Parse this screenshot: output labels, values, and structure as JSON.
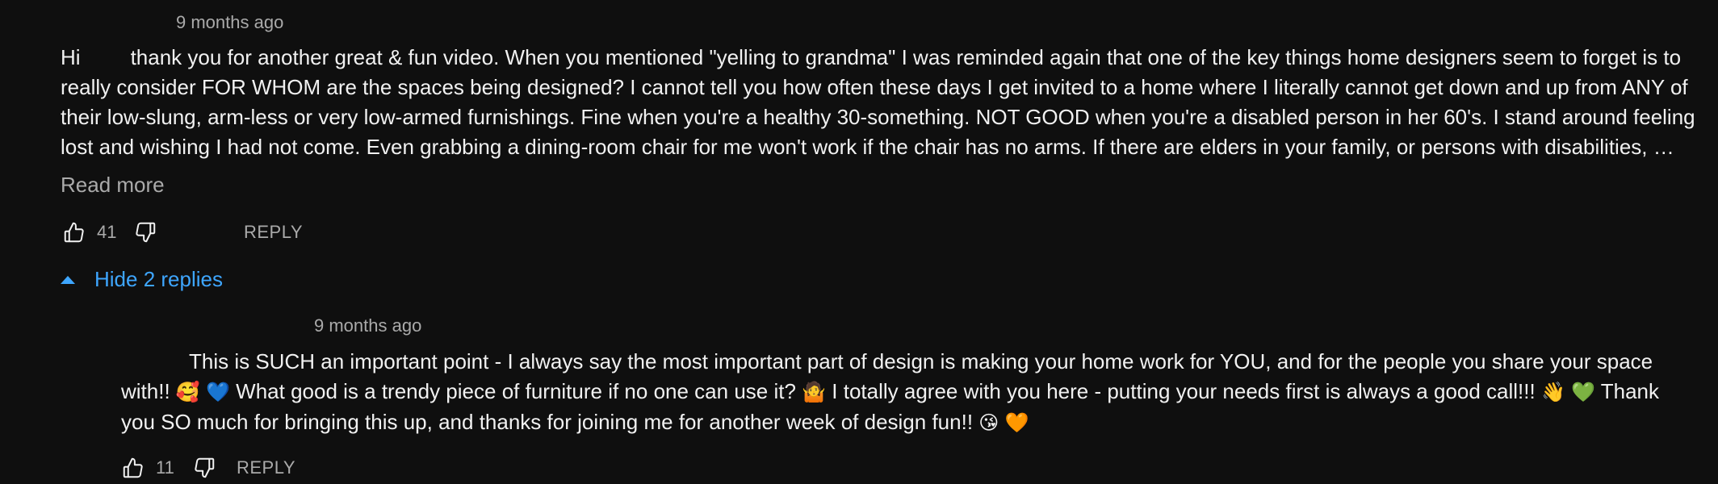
{
  "top_comment": {
    "timestamp": "9 months ago",
    "text_greeting": "Hi",
    "text_body": "thank you for another great & fun video. When you mentioned \"yelling to grandma\" I was reminded again that one of the key things home designers seem to forget is to really consider FOR WHOM are the spaces being designed? I cannot tell you how often these days I get invited to a home where I literally cannot get down and up from ANY of their low-slung, arm-less or very low-armed furnishings. Fine when you're a healthy 30-something. NOT GOOD when you're a disabled person in her 60's. I stand around feeling lost and wishing I had not come. Even grabbing a dining-room chair for me won't work if the chair has no arms. If there are elders in your family, or persons with disabilities, …",
    "read_more_label": "Read more",
    "like_count": "41",
    "reply_label": "REPLY"
  },
  "replies_toggle": {
    "label": "Hide 2 replies",
    "color": "#3ea6ff"
  },
  "reply_comment": {
    "timestamp": "9 months ago",
    "text_part1": "This is SUCH an important point - I always say the most important part of design is making your home work for YOU, and for the people you share your space with!!",
    "emoji_1": "🥰",
    "emoji_2": "💙",
    "text_part2": "What good is a trendy piece of furniture if no one can use it?",
    "emoji_3": "🤷",
    "text_part3": "I totally agree with you here - putting your needs first is always a good call!!!",
    "emoji_4": "👋",
    "emoji_5": "💚",
    "text_part4": "Thank you SO much for bringing this up, and thanks for joining me for another week of design fun!!",
    "emoji_6": "😘",
    "emoji_7": "🧡",
    "like_count": "11",
    "reply_label": "REPLY"
  },
  "icons": {
    "like": "thumbs-up-icon",
    "dislike": "thumbs-down-icon",
    "caret": "caret-up-icon"
  },
  "colors": {
    "background": "#0f0f0f",
    "text": "#f1f1f1",
    "secondary": "#aaaaaa",
    "link": "#3ea6ff"
  }
}
